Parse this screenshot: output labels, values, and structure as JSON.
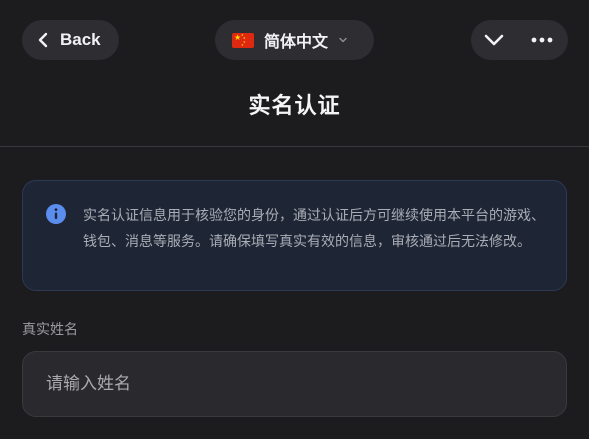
{
  "header": {
    "back_label": "Back",
    "language_label": "简体中文",
    "icons": {
      "back": "chevron-left-icon",
      "flag": "china-flag-icon",
      "language_caret": "chevron-down-icon",
      "collapse": "chevron-down-icon",
      "more": "more-dots-icon"
    }
  },
  "page": {
    "title": "实名认证"
  },
  "notice": {
    "icon": "info-icon",
    "text": "实名认证信息用于核验您的身份，通过认证后方可继续使用本平台的游戏、钱包、消息等服务。请确保填写真实有效的信息，审核通过后无法修改。"
  },
  "form": {
    "name_label": "真实姓名",
    "name_value": "",
    "name_placeholder": "请输入姓名"
  },
  "colors": {
    "background": "#1c1c1f",
    "pill": "#2e2e32",
    "notice_bg": "#1e2534",
    "notice_border": "#2d3a55",
    "info_accent": "#5b8def"
  }
}
